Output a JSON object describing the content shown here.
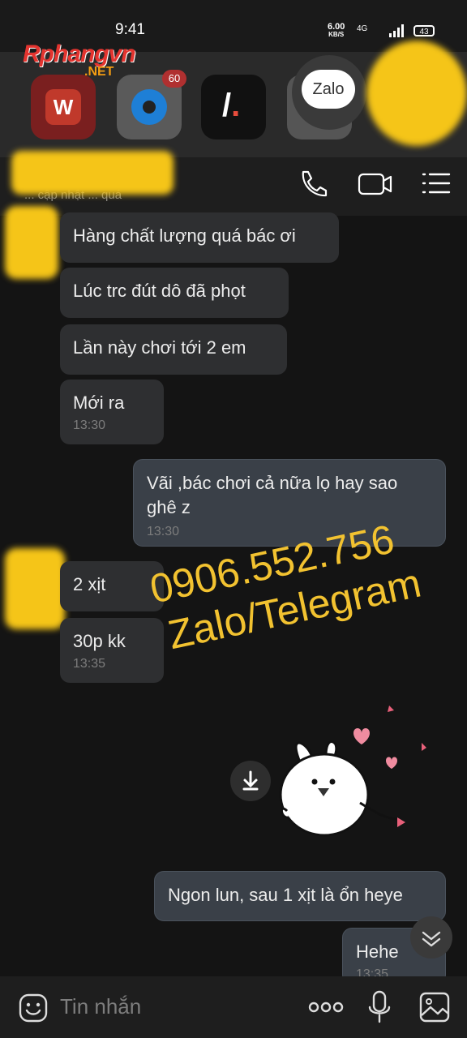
{
  "status_bar": {
    "time": "9:41",
    "speed": "6.00",
    "speed_unit": "KB/S",
    "network": "4G",
    "battery": "43"
  },
  "watermark": {
    "brand": "Rphangvn",
    "suffix": ".NET"
  },
  "apps": [
    {
      "name": "WPS"
    },
    {
      "name": "browser",
      "badge": "60"
    },
    {
      "name": "slash"
    },
    {
      "name": "Zalo",
      "label": "Zalo"
    }
  ],
  "chat_header": {
    "last_seen": "... cập nhật ... quá"
  },
  "messages": [
    {
      "side": "left",
      "text": "Hàng chất lượng quá bác ơi"
    },
    {
      "side": "left",
      "text": "Lúc trc đút dô đã phọt"
    },
    {
      "side": "left",
      "text": "Lần này chơi tới 2 em"
    },
    {
      "side": "left",
      "text": "Mới ra",
      "time": "13:30"
    },
    {
      "side": "right",
      "text": "Vãi ,bác chơi cả nữa lọ hay sao ghê z",
      "time": "13:30"
    },
    {
      "side": "left",
      "text": "2 xịt"
    },
    {
      "side": "left",
      "text": "30p kk",
      "time": "13:35"
    },
    {
      "side": "right",
      "text": "Ngon lun, sau 1 xịt là ổn heye"
    },
    {
      "side": "right",
      "text": "Hehe",
      "time": "13:35"
    }
  ],
  "promo": {
    "phone": "0906.552.756",
    "channels": "Zalo/Telegram"
  },
  "composer": {
    "placeholder": "Tin nhắn"
  }
}
